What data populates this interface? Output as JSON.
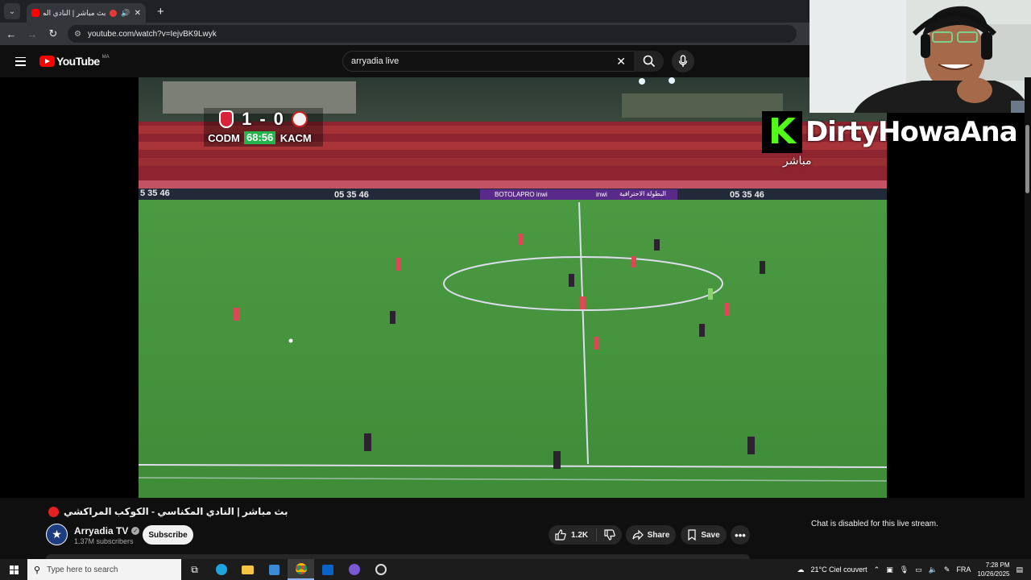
{
  "browser": {
    "tab_title": "بث مباشر | النادي المكناسي - الكوكب المراكشي",
    "url": "youtube.com/watch?v=IejvBK9Lwyk"
  },
  "youtube": {
    "logo_text": "YouTube",
    "region": "MA",
    "search_value": "arryadia live"
  },
  "scoreboard": {
    "home_score": "1",
    "separator": "-",
    "away_score": "0",
    "home_team": "CODM",
    "clock": "68:56",
    "away_team": "KACM",
    "home_color": "#d8233a",
    "away_color": "#f0f0f0"
  },
  "stadium_boards": {
    "time_left": "5 35 46",
    "time_1": "05 35 46",
    "sponsor": "BOTOLAPRO inwi",
    "sponsor_2": "inwi",
    "league_ar": "البطولة الاحترافية",
    "time_2": "05 35 46"
  },
  "overlay": {
    "kick_letter": "K",
    "streamer_name": "DirtyHowaAna",
    "live_ar": "مباشر",
    "kick_color": "#53fc18"
  },
  "video": {
    "title": "بث مباشر | النادي المكناسي - الكوكب المراكشي",
    "channel_name": "Arryadia TV",
    "subscribers": "1.37M subscribers",
    "subscribe_label": "Subscribe",
    "likes": "1.2K",
    "share_label": "Share",
    "save_label": "Save",
    "chat_notice": "Chat is disabled for this live stream."
  },
  "taskbar": {
    "search_placeholder": "Type here to search",
    "weather": "21°C  Ciel couvert",
    "language": "FRA",
    "time": "7:28 PM",
    "date": "10/26/2025"
  }
}
